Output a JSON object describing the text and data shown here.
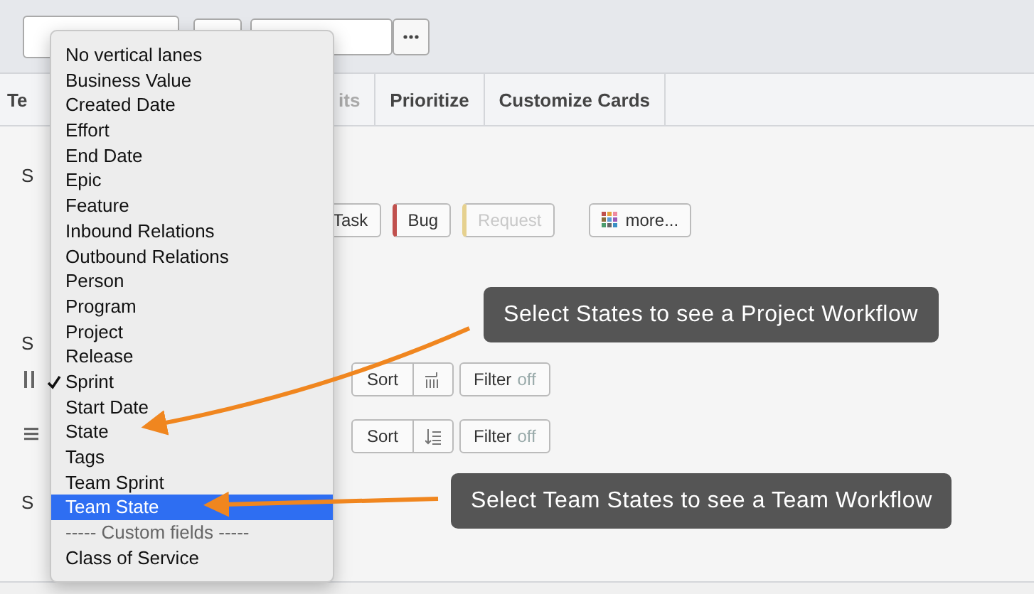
{
  "tabs": [
    {
      "label": "Te",
      "disabled": false
    },
    {
      "label": "its",
      "disabled": true
    },
    {
      "label": "Prioritize",
      "disabled": false
    },
    {
      "label": "Customize Cards",
      "disabled": false
    }
  ],
  "sections": [
    {
      "label": "S"
    },
    {
      "label": "S"
    },
    {
      "label": "S"
    }
  ],
  "card_types": [
    {
      "label": "Task",
      "disabled": false
    },
    {
      "label": "Bug",
      "color": "#c0504d",
      "disabled": false
    },
    {
      "label": "Request",
      "color": "#e6d18f",
      "disabled": true
    }
  ],
  "more_button": "more...",
  "sort_rows": [
    {
      "kind": "columns",
      "sort": "Sort",
      "filter": "Filter",
      "filter_state": "off"
    },
    {
      "kind": "rows",
      "sort": "Sort",
      "filter": "Filter",
      "filter_state": "off"
    }
  ],
  "menu": {
    "items": [
      {
        "label": "No vertical lanes",
        "kind": "option",
        "checked": false,
        "selected": false
      },
      {
        "label": "Business Value",
        "kind": "option",
        "checked": false,
        "selected": false
      },
      {
        "label": "Created Date",
        "kind": "option",
        "checked": false,
        "selected": false
      },
      {
        "label": "Effort",
        "kind": "option",
        "checked": false,
        "selected": false
      },
      {
        "label": "End Date",
        "kind": "option",
        "checked": false,
        "selected": false
      },
      {
        "label": "Epic",
        "kind": "option",
        "checked": false,
        "selected": false
      },
      {
        "label": "Feature",
        "kind": "option",
        "checked": false,
        "selected": false
      },
      {
        "label": "Inbound Relations",
        "kind": "option",
        "checked": false,
        "selected": false
      },
      {
        "label": "Outbound Relations",
        "kind": "option",
        "checked": false,
        "selected": false
      },
      {
        "label": "Person",
        "kind": "option",
        "checked": false,
        "selected": false
      },
      {
        "label": "Program",
        "kind": "option",
        "checked": false,
        "selected": false
      },
      {
        "label": "Project",
        "kind": "option",
        "checked": false,
        "selected": false
      },
      {
        "label": "Release",
        "kind": "option",
        "checked": false,
        "selected": false
      },
      {
        "label": "Sprint",
        "kind": "option",
        "checked": true,
        "selected": false
      },
      {
        "label": "Start Date",
        "kind": "option",
        "checked": false,
        "selected": false
      },
      {
        "label": "State",
        "kind": "option",
        "checked": false,
        "selected": false
      },
      {
        "label": "Tags",
        "kind": "option",
        "checked": false,
        "selected": false
      },
      {
        "label": "Team Sprint",
        "kind": "option",
        "checked": false,
        "selected": false
      },
      {
        "label": "Team State",
        "kind": "option",
        "checked": false,
        "selected": true
      },
      {
        "label": "----- Custom fields -----",
        "kind": "separator"
      },
      {
        "label": "Class of Service",
        "kind": "option",
        "checked": false,
        "selected": false
      }
    ]
  },
  "callouts": [
    {
      "text": "Select States to see a Project Workflow"
    },
    {
      "text": "Select Team States to see a Team Workflow"
    }
  ]
}
